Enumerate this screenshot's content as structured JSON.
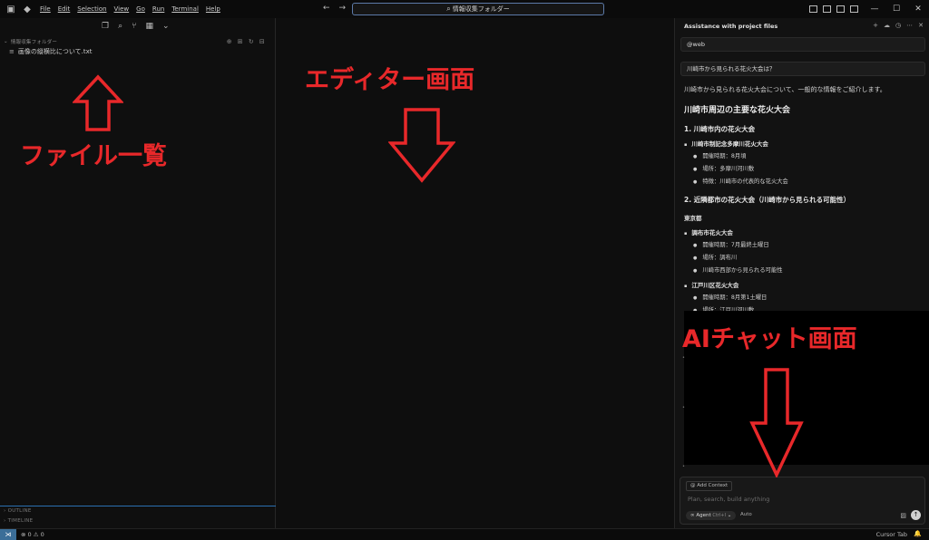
{
  "titlebar": {
    "menu": [
      "File",
      "Edit",
      "Selection",
      "View",
      "Go",
      "Run",
      "Terminal",
      "Help"
    ],
    "search": "情報収集フォルダー",
    "icons": [
      "sidebar-toggle-icon",
      "cursor-logo-icon",
      "back-arrow-icon",
      "forward-arrow-icon",
      "minimize-icon",
      "maximize-icon",
      "close-icon"
    ]
  },
  "sidebar": {
    "folder_header": "情報収集フォルダー",
    "file": "画像の縦横比について.txt",
    "sections": [
      "OUTLINE",
      "TIMELINE"
    ]
  },
  "chat": {
    "title": "Assistance with project files",
    "web_chip": "@web",
    "user_question": "川崎市から見られる花火大会は？",
    "response": {
      "intro": "川崎市から見られる花火大会について、一般的な情報をご紹介します。",
      "heading": "川崎市周辺の主要な花火大会",
      "sec1": "1. 川崎市内の花火大会",
      "ev1": "川崎市制記念多摩川花火大会",
      "ev1_items": [
        "開催時期：8月頃",
        "場所：多摩川河川敷",
        "特徴：川崎市の代表的な花火大会"
      ],
      "sec2": "2. 近隣都市の花火大会（川崎市から見られる可能性）",
      "tokyo": "東京都",
      "ev2": "調布市花火大会",
      "ev2_items": [
        "開催時期：7月最終土曜日",
        "場所：調布川",
        "川崎市西部から見られる可能性"
      ],
      "ev3": "江戸川区花火大会",
      "ev3_items": [
        "開催時期：8月第1土曜日",
        "場所：江戸川河川敷"
      ]
    },
    "input": {
      "add_context": "Add Context",
      "placeholder": "Plan, search, build anything",
      "agent": "Agent",
      "agent_key": "Ctrl+I",
      "auto": "Auto"
    }
  },
  "statusbar": {
    "problems": "⊗ 0 ⚠ 0",
    "cursor_tab": "Cursor Tab"
  },
  "annotations": {
    "file_list": "ファイル一覧",
    "editor": "エディター画面",
    "ai_chat": "AIチャット画面",
    "color": "#e8282a"
  }
}
